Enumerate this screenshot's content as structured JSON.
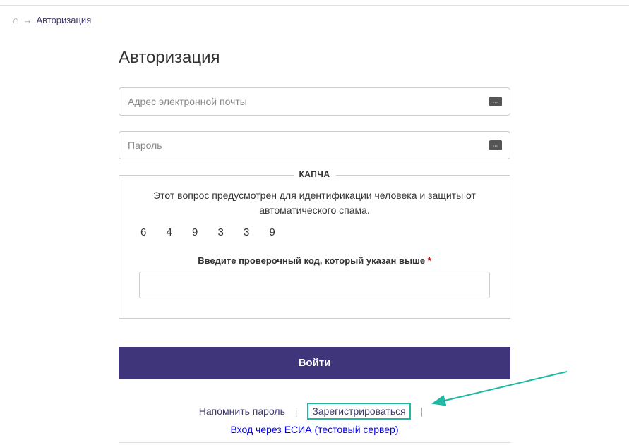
{
  "breadcrumb": {
    "current": "Авторизация"
  },
  "page": {
    "title": "Авторизация"
  },
  "form": {
    "email_placeholder": "Адрес электронной почты",
    "password_placeholder": "Пароль",
    "submit_label": "Войти"
  },
  "captcha": {
    "legend": "КАПЧА",
    "description": "Этот вопрос предусмотрен для идентификации человека и защиты от автоматического спама.",
    "code": "6 4 9 3 3 9",
    "input_label": "Введите проверочный код, который указан выше",
    "required_mark": "*"
  },
  "links": {
    "remind_password": "Напомнить пароль",
    "register": "Зарегистрироваться",
    "esia": "Вход через ЕСИА (тестовый сервер)",
    "separator": "|"
  }
}
